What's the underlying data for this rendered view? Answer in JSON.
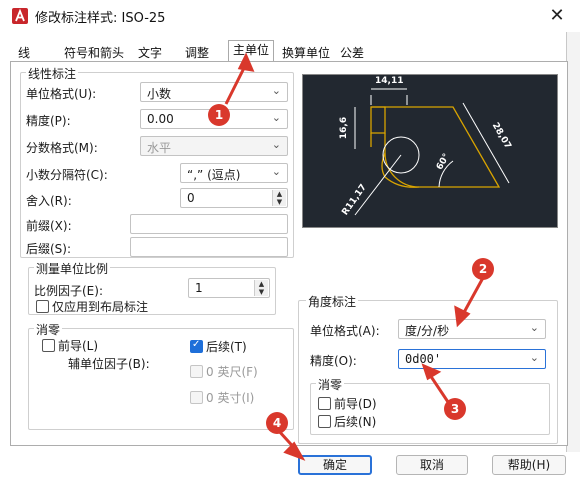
{
  "window": {
    "title": "修改标注样式: ISO-25",
    "close_label": "✕"
  },
  "tabs": [
    {
      "label": "线"
    },
    {
      "label": "符号和箭头"
    },
    {
      "label": "文字"
    },
    {
      "label": "调整"
    },
    {
      "label": "主单位",
      "active": true
    },
    {
      "label": "换算单位"
    },
    {
      "label": "公差"
    }
  ],
  "linear": {
    "group_label": "线性标注",
    "unit_format": {
      "label": "单位格式(U):",
      "value": "小数"
    },
    "precision": {
      "label": "精度(P):",
      "value": "0.00"
    },
    "fraction_format": {
      "label": "分数格式(M):",
      "value": "水平"
    },
    "decimal_separator": {
      "label": "小数分隔符(C):",
      "value": "“,” (逗点)"
    },
    "round_off": {
      "label": "舍入(R):",
      "value": "0"
    },
    "prefix": {
      "label": "前缀(X):",
      "value": ""
    },
    "suffix": {
      "label": "后缀(S):",
      "value": ""
    }
  },
  "scale": {
    "group_label": "测量单位比例",
    "factor": {
      "label": "比例因子(E):",
      "value": "1"
    },
    "layout_only": {
      "label": "仅应用到布局标注",
      "checked": false
    }
  },
  "zero_suppression": {
    "group_label": "消零",
    "leading": {
      "label": "前导(L)",
      "checked": false
    },
    "sub_unit_factor_label": "辅单位因子(B):",
    "trailing": {
      "label": "后续(T)",
      "checked": true
    },
    "feet": {
      "label": "0 英尺(F)",
      "checked": false
    },
    "inches": {
      "label": "0 英寸(I)",
      "checked": false
    }
  },
  "preview": {
    "dims": [
      "14,11",
      "16,6",
      "28,07",
      "60°",
      "R11,17"
    ]
  },
  "angular": {
    "group_label": "角度标注",
    "unit_format": {
      "label": "单位格式(A):",
      "value": "度/分/秒"
    },
    "precision": {
      "label": "精度(O):",
      "value": "0d00'"
    },
    "zero_group_label": "消零",
    "leading": {
      "label": "前导(D)",
      "checked": false
    },
    "trailing": {
      "label": "后续(N)",
      "checked": false
    }
  },
  "buttons": {
    "ok": "确定",
    "cancel": "取消",
    "help": "帮助(H)"
  },
  "annotations": {
    "b1": "1",
    "b2": "2",
    "b3": "3",
    "b4": "4",
    "color": "#d9382c"
  }
}
